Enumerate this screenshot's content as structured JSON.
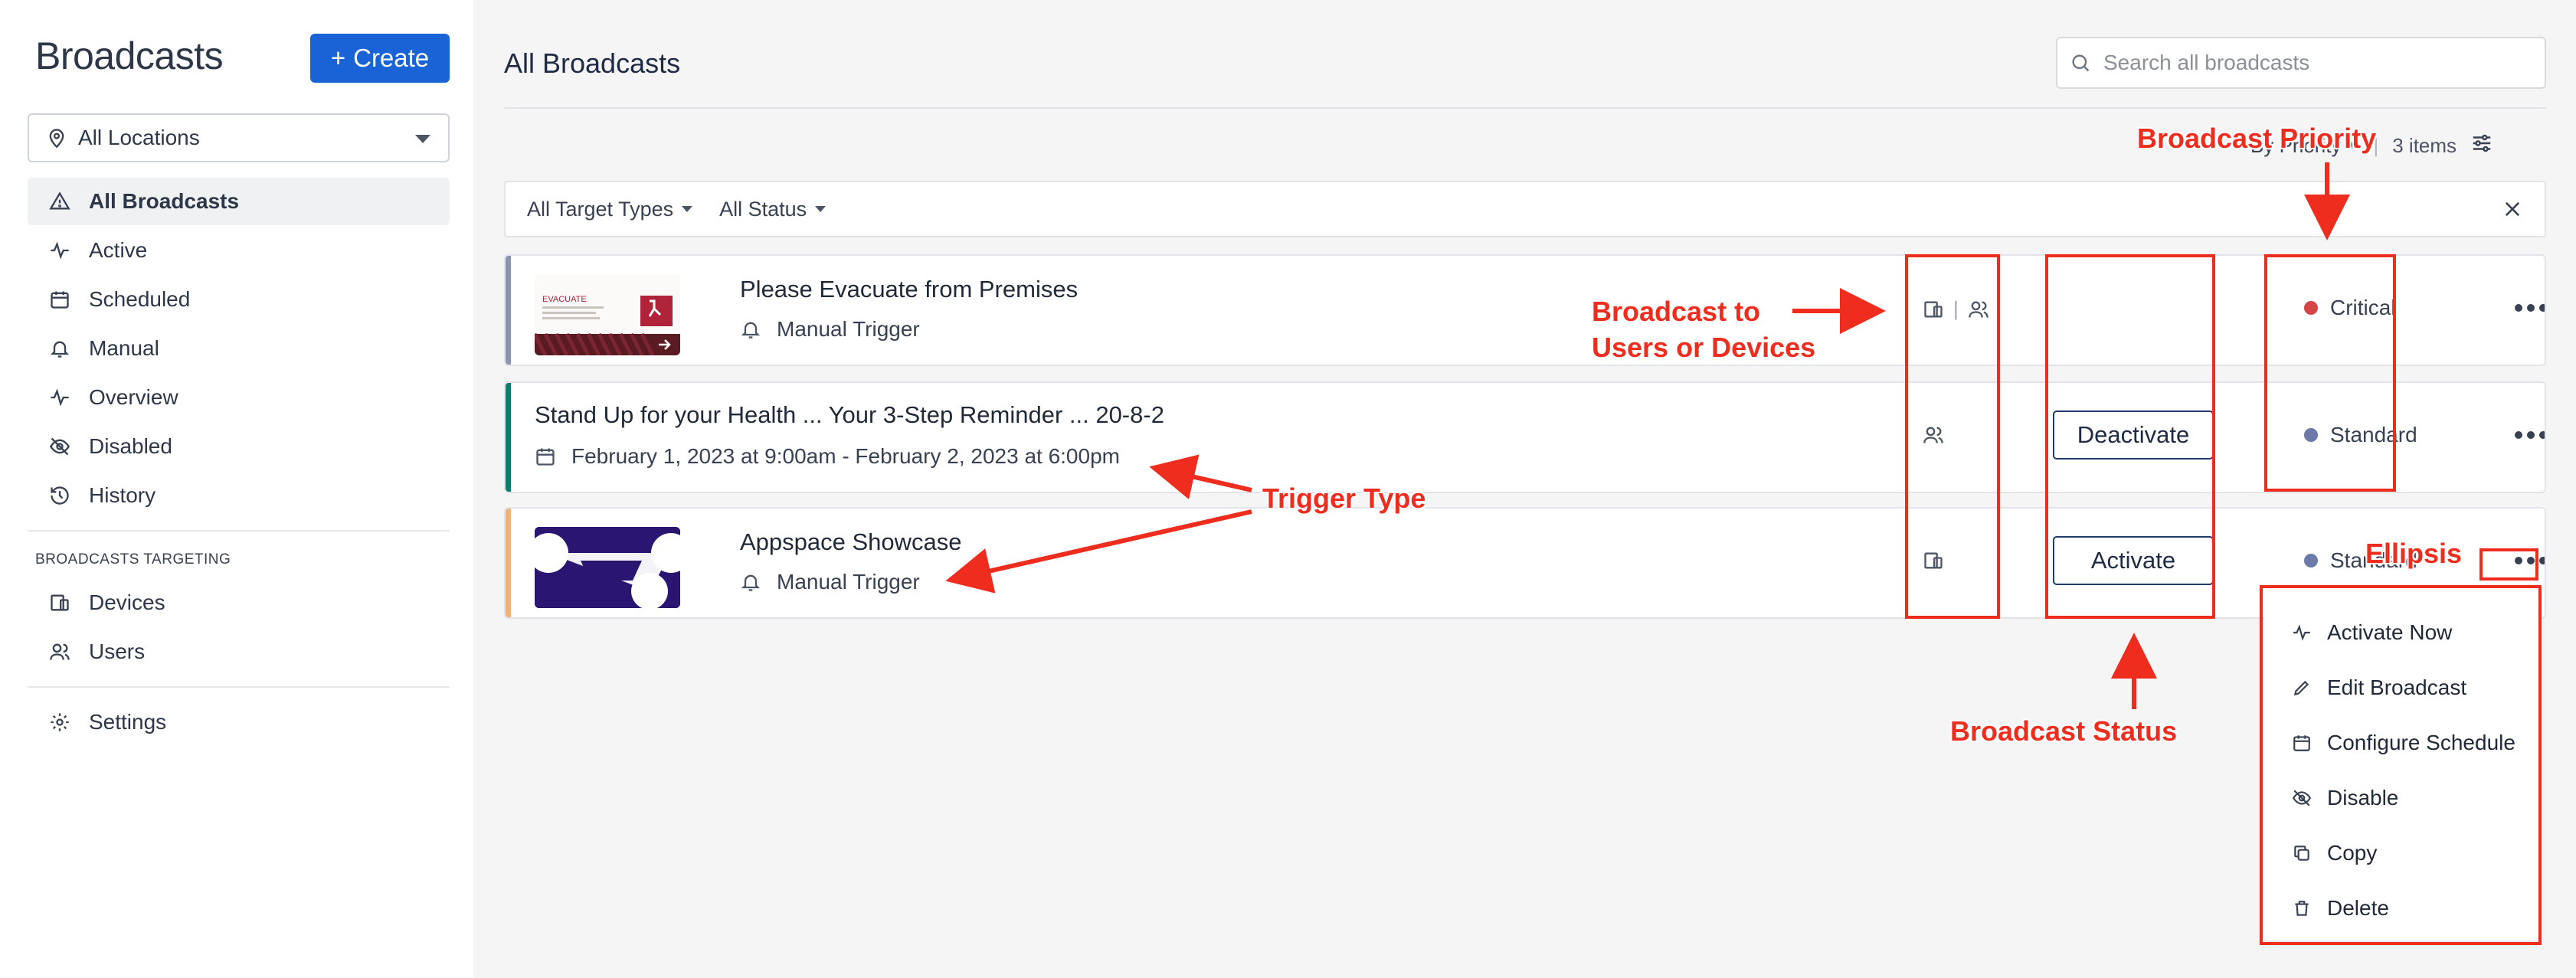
{
  "sidebar": {
    "title": "Broadcasts",
    "create_label": "Create",
    "location": "All Locations",
    "nav": [
      {
        "label": "All Broadcasts"
      },
      {
        "label": "Active"
      },
      {
        "label": "Scheduled"
      },
      {
        "label": "Manual"
      },
      {
        "label": "Overview"
      },
      {
        "label": "Disabled"
      },
      {
        "label": "History"
      }
    ],
    "targeting_caption": "BROADCASTS TARGETING",
    "targeting": [
      {
        "label": "Devices"
      },
      {
        "label": "Users"
      }
    ],
    "settings_label": "Settings"
  },
  "main": {
    "title": "All Broadcasts",
    "search_placeholder": "Search all broadcasts",
    "sort_label": "By Priority",
    "item_count": "3 items",
    "filters": {
      "target_types": "All Target Types",
      "status": "All Status"
    },
    "rows": [
      {
        "title": "Please Evacuate from Premises",
        "subtitle": "Manual Trigger",
        "priority": "Critical",
        "thumb_text": "EVACUATE",
        "accent": "#8a93b0"
      },
      {
        "title": "Stand Up for your Health ... Your 3-Step Reminder ... 20-8-2",
        "subtitle": "February 1, 2023 at 9:00am - February 2, 2023 at 6:00pm",
        "status_button": "Deactivate",
        "priority": "Standard",
        "accent": "#0f7b6c"
      },
      {
        "title": "Appspace Showcase",
        "subtitle": "Manual Trigger",
        "status_button": "Activate",
        "priority": "Standard",
        "accent": "#f0b27a"
      }
    ],
    "menu": [
      {
        "label": "Activate Now",
        "icon": "pulse-icon"
      },
      {
        "label": "Edit Broadcast",
        "icon": "pencil-icon"
      },
      {
        "label": "Configure Schedule",
        "icon": "calendar-icon"
      },
      {
        "label": "Disable",
        "icon": "eye-off-icon"
      },
      {
        "label": "Copy",
        "icon": "copy-icon"
      },
      {
        "label": "Delete",
        "icon": "trash-icon"
      }
    ]
  },
  "annotations": {
    "priority": "Broadcast Priority",
    "target": "Broadcast to\nUsers or Devices",
    "trigger": "Trigger Type",
    "ellipsis": "Ellipsis",
    "status": "Broadcast Status"
  },
  "colors": {
    "brand": "#1a63d6",
    "critical": "#d64545",
    "standard": "#6b7aa8",
    "annotation": "#ef2d1f"
  }
}
